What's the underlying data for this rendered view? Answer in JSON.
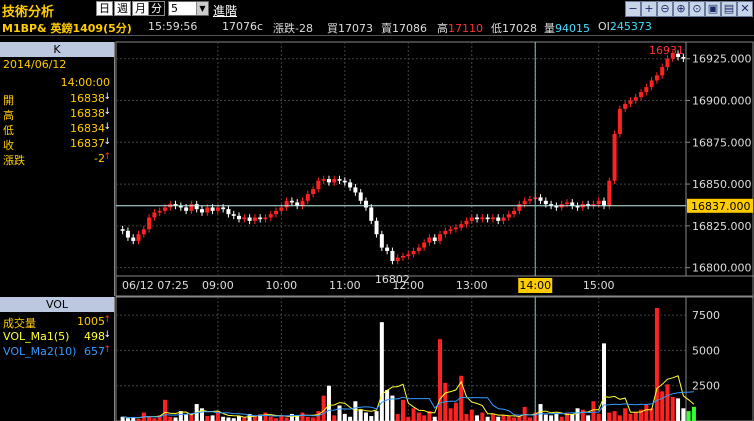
{
  "app": {
    "title": "技術分析"
  },
  "toolbar": {
    "period_buttons": [
      "日",
      "週",
      "月",
      "分"
    ],
    "active_period": "分",
    "interval_value": "5",
    "advanced_label": "進階",
    "window_buttons": [
      "minus-icon",
      "plus-icon",
      "zoom-out-icon",
      "zoom-in-icon",
      "zoom-fit-icon",
      "save-icon",
      "print-icon",
      "close-icon"
    ]
  },
  "quote": {
    "symbol": "M1BP& 英鎊1409(5分)",
    "time": "15:59:56",
    "price": "17076c",
    "change_label": "漲跌",
    "change_value": "-28",
    "bid_label": "買",
    "bid_value": "17073",
    "ask_label": "賣",
    "ask_value": "17086",
    "high_label": "高",
    "high_value": "17110",
    "low_label": "低",
    "low_value": "17028",
    "volume_label": "量",
    "volume_value": "94015",
    "oi_label": "OI",
    "oi_value": "245373"
  },
  "price_panel": {
    "header": "K",
    "date": "2014/06/12",
    "time": "14:00:00",
    "rows": [
      {
        "label": "開",
        "value": "16838",
        "arrow": "↓",
        "arrow_color": "#ffffff"
      },
      {
        "label": "高",
        "value": "16838",
        "arrow": "↓",
        "arrow_color": "#ffffff"
      },
      {
        "label": "低",
        "value": "16834",
        "arrow": "↓",
        "arrow_color": "#ffffff"
      },
      {
        "label": "收",
        "value": "16837",
        "arrow": "↓",
        "arrow_color": "#ffffff"
      },
      {
        "label": "漲跌",
        "value": "-2",
        "arrow": "↑",
        "arrow_color": "#ff3333"
      }
    ]
  },
  "vol_panel": {
    "header": "VOL",
    "rows": [
      {
        "label": "成交量",
        "value": "1005",
        "arrow": "↑",
        "color": "#ffcc00",
        "arrow_color": "#ff3333"
      },
      {
        "label": "VOL_Ma1(5)",
        "value": "498",
        "arrow": "↓",
        "color": "#ffff33",
        "arrow_color": "#ffffff"
      },
      {
        "label": "VOL_Ma2(10)",
        "value": "657",
        "arrow": "↑",
        "color": "#3399ff",
        "arrow_color": "#ff3333"
      }
    ]
  },
  "chart_data": [
    {
      "type": "candlestick",
      "title": "",
      "x_labels": [
        "06/12 07:25",
        "09:00",
        "10:00",
        "11:00",
        "12:00",
        "13:00",
        "14:00",
        "15:00"
      ],
      "crosshair_time": "14:00",
      "crosshair_price": "16837.000",
      "y_ticks": [
        "16925.000",
        "16900.000",
        "16875.000",
        "16850.000",
        "16825.000",
        "16800.000"
      ],
      "ylim": [
        16795,
        16935
      ],
      "annotations": [
        {
          "text": "16931"
        },
        {
          "text": "16802"
        }
      ],
      "colors": {
        "up": "#ff2222",
        "down": "#ffffff",
        "flat": "#33ff33"
      },
      "close": [
        16822,
        16818,
        16816,
        16820,
        16823,
        16830,
        16833,
        16834,
        16836,
        16838,
        16837,
        16836,
        16834,
        16838,
        16835,
        16833,
        16836,
        16834,
        16836,
        16835,
        16832,
        16831,
        16829,
        16830,
        16828,
        16830,
        16829,
        16830,
        16832,
        16834,
        16836,
        16840,
        16839,
        16837,
        16840,
        16844,
        16847,
        16852,
        16853,
        16851,
        16853,
        16852,
        16851,
        16848,
        16845,
        16840,
        16836,
        16828,
        16820,
        16812,
        16810,
        16804,
        16806,
        16807,
        16808,
        16810,
        16812,
        16815,
        16818,
        16816,
        16820,
        16822,
        16823,
        16824,
        16826,
        16828,
        16830,
        16829,
        16830,
        16829,
        16830,
        16828,
        16830,
        16832,
        16834,
        16838,
        16840,
        16841,
        16842,
        16840,
        16838,
        16837,
        16836,
        16838,
        16839,
        16837,
        16836,
        16838,
        16837,
        16838,
        16840,
        16837,
        16852,
        16880,
        16895,
        16898,
        16900,
        16902,
        16905,
        16908,
        16912,
        16915,
        16920,
        16925,
        16928,
        16926,
        16925
      ]
    },
    {
      "type": "bar",
      "title": "VOL",
      "y_ticks": [
        "7500",
        "5000",
        "2500"
      ],
      "ylim": [
        0,
        8500
      ],
      "series_names": [
        "VOL_Ma1(5)",
        "VOL_Ma2(10)"
      ],
      "values": [
        300,
        200,
        250,
        150,
        600,
        350,
        200,
        400,
        1500,
        300,
        250,
        700,
        450,
        500,
        1200,
        900,
        350,
        400,
        700,
        300,
        250,
        200,
        350,
        250,
        500,
        400,
        450,
        600,
        300,
        200,
        350,
        250,
        500,
        400,
        600,
        300,
        250,
        700,
        1800,
        2500,
        400,
        1100,
        500,
        300,
        1400,
        800,
        600,
        350,
        700,
        7000,
        2200,
        1800,
        500,
        1500,
        300,
        900,
        600,
        400,
        700,
        300,
        5800,
        2700,
        900,
        1300,
        3200,
        500,
        800,
        400,
        600,
        300,
        500,
        300,
        400,
        350,
        250,
        300,
        1000,
        250,
        600,
        1200,
        450,
        400,
        500,
        300,
        600,
        500,
        900,
        800,
        400,
        1400,
        500,
        5500,
        600,
        700,
        400,
        900,
        500,
        600,
        800,
        1200,
        900,
        8000,
        2100,
        2600,
        1700,
        1600,
        900,
        700,
        1005
      ]
    }
  ]
}
